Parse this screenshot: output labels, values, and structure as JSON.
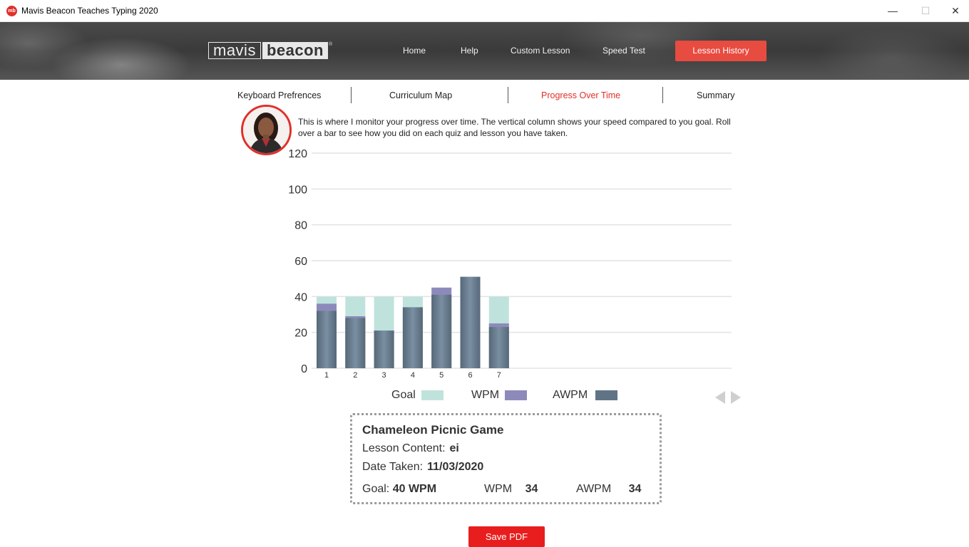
{
  "window": {
    "title": "Mavis Beacon Teaches Typing 2020",
    "app_icon": "mb"
  },
  "logo": {
    "part1": "mavis",
    "part2": "beacon",
    "mark": "®"
  },
  "nav": {
    "home": "Home",
    "help": "Help",
    "custom_lesson": "Custom Lesson",
    "speed_test": "Speed Test",
    "lesson_history": "Lesson History"
  },
  "tabs": {
    "keyboard": "Keyboard Prefrences",
    "curriculum": "Curriculum Map",
    "progress": "Progress Over Time",
    "summary": "Summary"
  },
  "intro": "This is where I monitor your progress over time. The vertical column shows your speed compared to you goal. Roll over a bar to see how you did on each quiz and lesson you have taken.",
  "chart_data": {
    "type": "bar",
    "categories": [
      "1",
      "2",
      "3",
      "4",
      "5",
      "6",
      "7"
    ],
    "series": [
      {
        "name": "Goal",
        "values": [
          40,
          40,
          40,
          40,
          40,
          40,
          40
        ]
      },
      {
        "name": "WPM",
        "values": [
          36,
          29,
          21,
          34,
          45,
          51,
          25
        ]
      },
      {
        "name": "AWPM",
        "values": [
          32,
          28,
          21,
          34,
          41,
          51,
          23
        ]
      }
    ],
    "ylim": [
      0,
      120
    ],
    "yticks": [
      "0",
      "20",
      "40",
      "60",
      "80",
      "100",
      "120"
    ],
    "grid": true,
    "legend": "bottom",
    "colors": {
      "Goal": "#bfe3dc",
      "WPM": "#8d8abb",
      "AWPM": "#617486"
    }
  },
  "legend": {
    "goal": "Goal",
    "wpm": "WPM",
    "awpm": "AWPM"
  },
  "details": {
    "title": "Chameleon Picnic Game",
    "lesson_content_label": "Lesson Content:",
    "lesson_content_value": "ei",
    "date_label": "Date Taken:",
    "date_value": "11/03/2020",
    "goal_label": "Goal:",
    "goal_value": "40 WPM",
    "wpm_label": "WPM",
    "wpm_value": "34",
    "awpm_label": "AWPM",
    "awpm_value": "34"
  },
  "save_pdf": "Save PDF"
}
